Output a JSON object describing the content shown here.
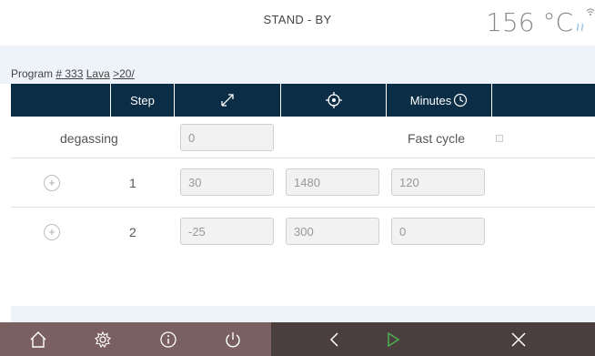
{
  "header": {
    "status": "STAND - BY",
    "temperature": "156 °C"
  },
  "breadcrumb": {
    "prefix": "Program ",
    "program": "# 333",
    "material": "Lava",
    "next": ">20/"
  },
  "table": {
    "columns": [
      {
        "label": "",
        "icon": null
      },
      {
        "label": "Step",
        "icon": null
      },
      {
        "label": "",
        "icon": "temperature-rate-icon"
      },
      {
        "label": "",
        "icon": "target-temperature-icon"
      },
      {
        "label": "Minutes",
        "icon": "clock-icon"
      },
      {
        "label": "",
        "icon": null
      }
    ],
    "degassing": {
      "label": "degassing",
      "value": "0",
      "fast_cycle_label": "Fast cycle"
    },
    "steps": [
      {
        "step": "1",
        "rate": "30",
        "temp": "1480",
        "minutes": "120"
      },
      {
        "step": "2",
        "rate": "-25",
        "temp": "300",
        "minutes": "0"
      }
    ]
  },
  "footer": {
    "left_icons": [
      "home-icon",
      "settings-icon",
      "info-icon",
      "power-icon"
    ],
    "right_icons": [
      "back-icon",
      "play-icon",
      "close-icon"
    ],
    "colors": {
      "left": "#7a6060",
      "right": "#4b3e3e",
      "play": "#4caf50"
    }
  }
}
